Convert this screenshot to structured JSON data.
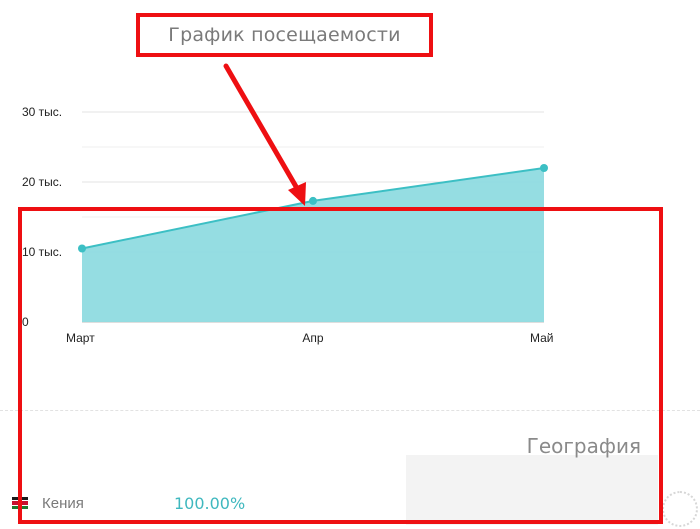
{
  "annotation": {
    "title_callout": "График посещаемости",
    "color": "#ee0f12"
  },
  "chart_data": {
    "type": "area",
    "categories": [
      "Март",
      "Апр",
      "Май"
    ],
    "values": [
      10500,
      17300,
      22000
    ],
    "ylim": [
      0,
      30000
    ],
    "yticks": [
      {
        "value": 0,
        "label": "0"
      },
      {
        "value": 10000,
        "label": "10 тыс."
      },
      {
        "value": 20000,
        "label": "20 тыс."
      },
      {
        "value": 30000,
        "label": "30 тыс."
      }
    ],
    "grid": true,
    "line_color": "#3cbfc4",
    "fill_color": "#8fdbe0"
  },
  "geography": {
    "title": "География",
    "countries": [
      {
        "name": "Кения",
        "value": "100.00%",
        "flag_icon": "kenya-flag-icon"
      }
    ],
    "accent_color": "#3fb8bf"
  }
}
